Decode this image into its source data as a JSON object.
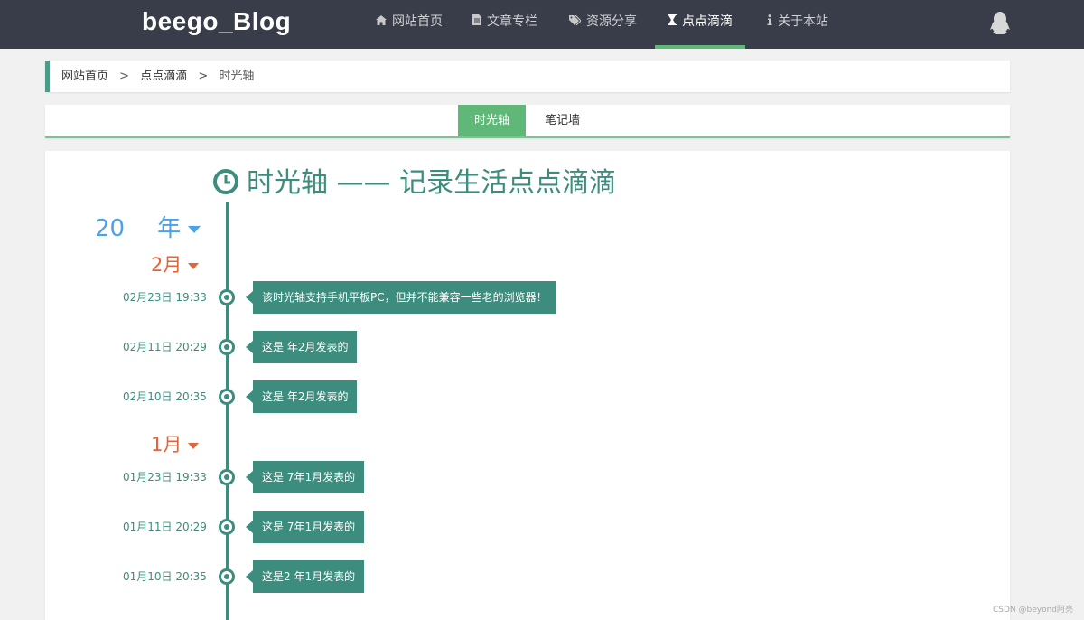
{
  "nav": {
    "brand": "beego_Blog",
    "items": [
      {
        "label": "网站首页",
        "icon": "home-icon"
      },
      {
        "label": "文章专栏",
        "icon": "document-icon"
      },
      {
        "label": "资源分享",
        "icon": "tags-icon"
      },
      {
        "label": "点点滴滴",
        "icon": "hourglass-icon",
        "active": true
      },
      {
        "label": "关于本站",
        "icon": "info-icon"
      }
    ],
    "user_icon": "qq-penguin-icon"
  },
  "breadcrumb": {
    "items": [
      "网站首页",
      "点点滴滴",
      "时光轴"
    ],
    "separator": ">"
  },
  "tabs": [
    {
      "label": "时光轴",
      "active": true
    },
    {
      "label": "笔记墙",
      "active": false
    }
  ],
  "timeline": {
    "title": "时光轴 —— 记录生活点点滴滴",
    "year_label_start": "20",
    "year_label_end": "年",
    "months": [
      {
        "label": "2月",
        "entries": [
          {
            "date": "02月23日 19:33",
            "text": "该时光轴支持手机平板PC，但并不能兼容一些老的浏览器！"
          },
          {
            "date": "02月11日 20:29",
            "text": "这是     年2月发表的"
          },
          {
            "date": "02月10日 20:35",
            "text": "这是     年2月发表的"
          }
        ]
      },
      {
        "label": "1月",
        "entries": [
          {
            "date": "01月23日 19:33",
            "text": "这是     7年1月发表的"
          },
          {
            "date": "01月11日 20:29",
            "text": "这是     7年1月发表的"
          },
          {
            "date": "01月10日 20:35",
            "text": "这是2    年1月发表的"
          }
        ]
      }
    ]
  },
  "colors": {
    "navbar_bg": "#393d49",
    "accent_green": "#5fb878",
    "timeline_teal": "#3c8d7e",
    "year_blue": "#4aa3e8",
    "month_orange": "#e0653a"
  },
  "watermark": "CSDN @beyond阿亮"
}
